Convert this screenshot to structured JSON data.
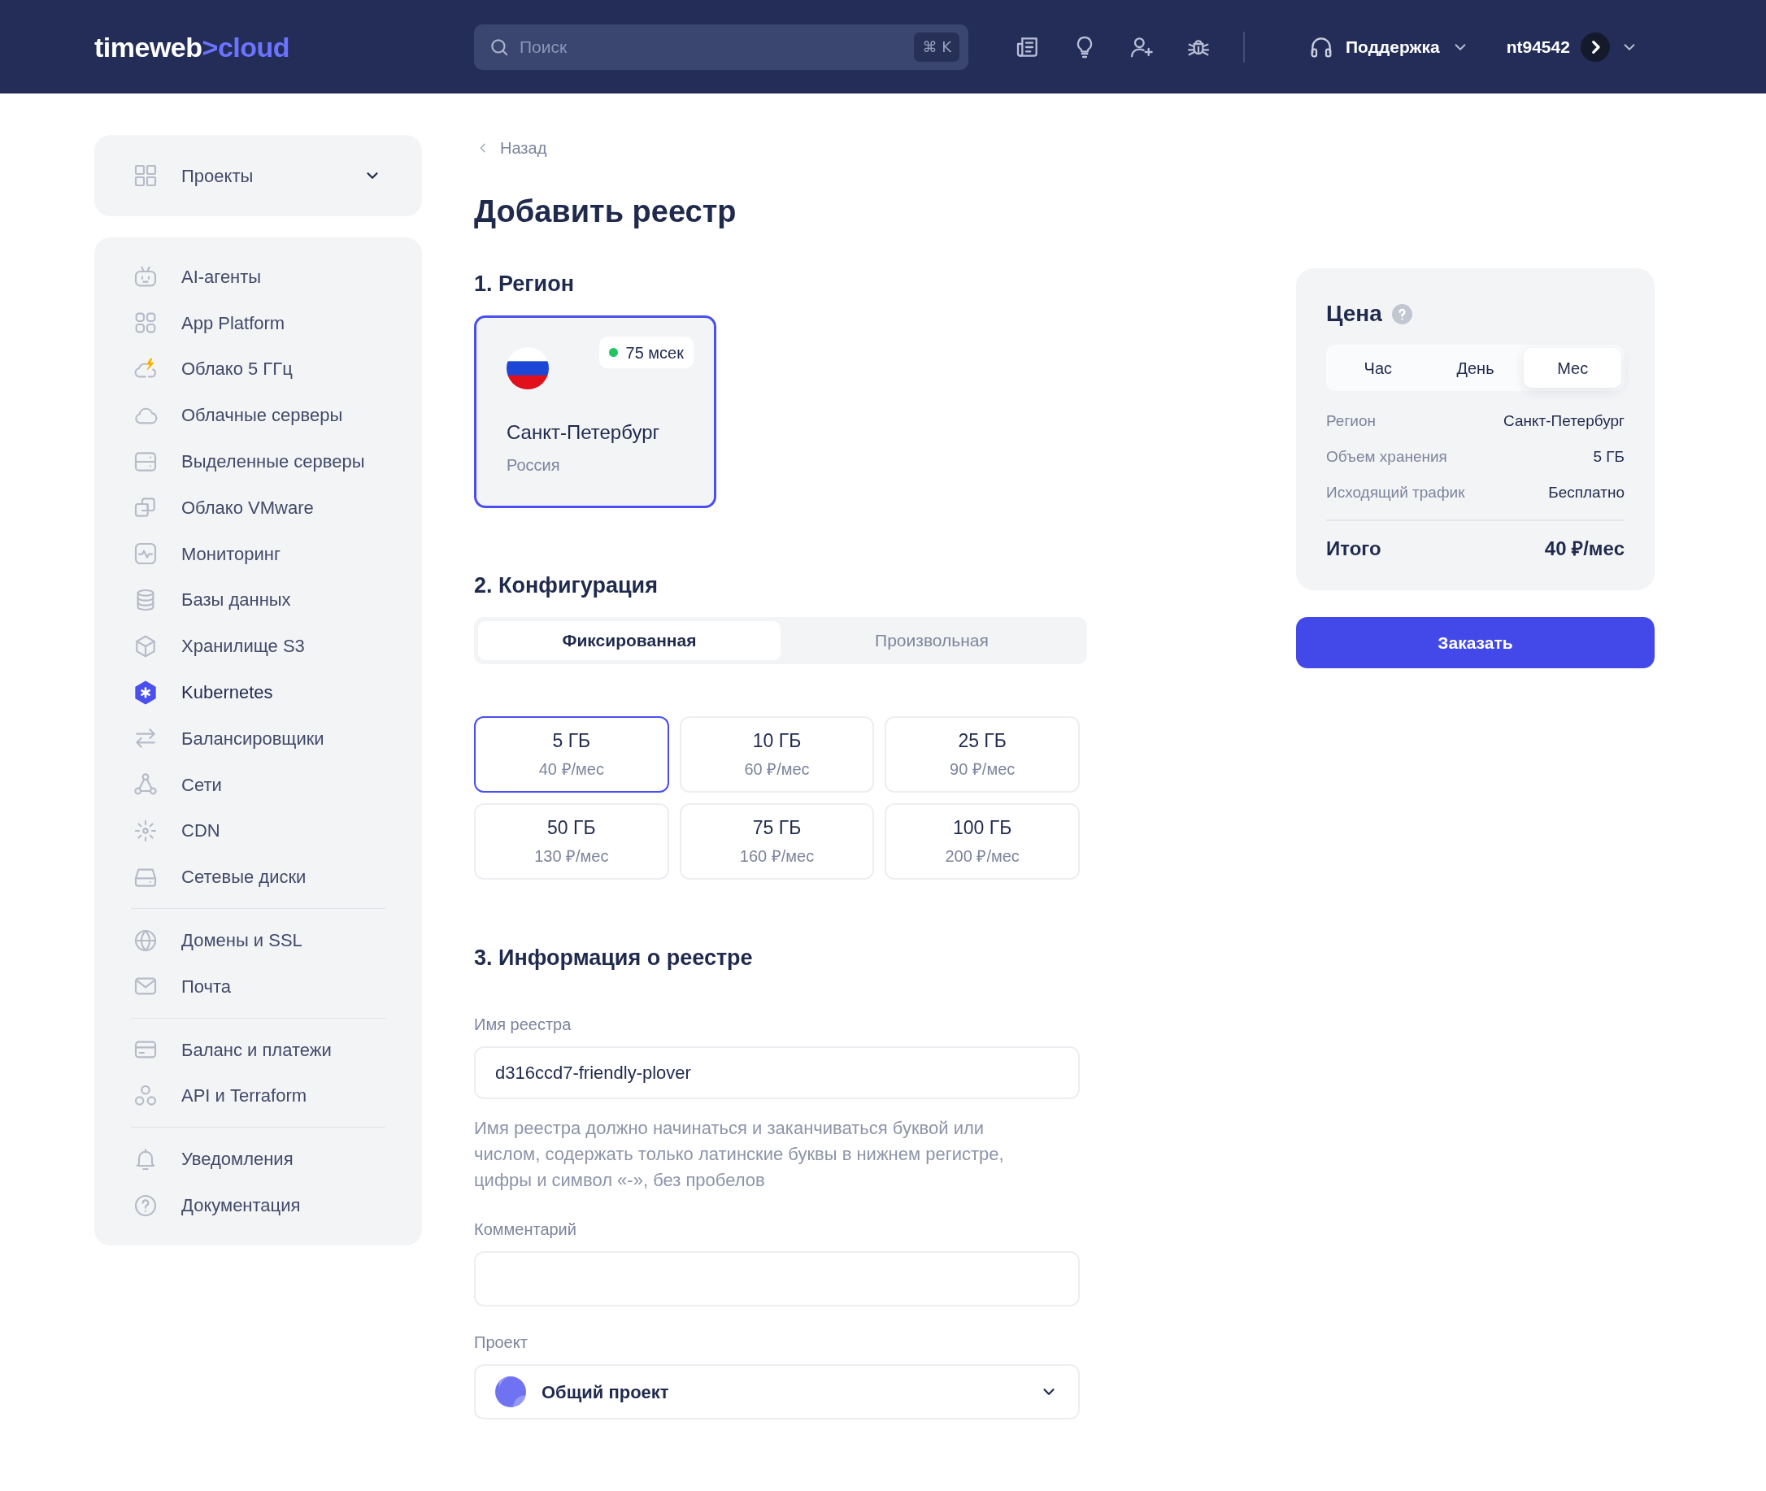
{
  "header": {
    "logo": {
      "wordmark": "timeweb",
      "separator": ">",
      "product": "cloud"
    },
    "search": {
      "placeholder": "Поиск",
      "shortcut": "⌘ K"
    },
    "support": {
      "label": "Поддержка"
    },
    "account": {
      "username": "nt94542"
    }
  },
  "sidebar": {
    "projects": {
      "label": "Проекты"
    },
    "groups": [
      {
        "items": [
          {
            "label": "AI-агенты",
            "selected": false
          },
          {
            "label": "App Platform",
            "selected": false
          },
          {
            "label": "Облако 5 ГГц",
            "selected": false
          },
          {
            "label": "Облачные серверы",
            "selected": false
          },
          {
            "label": "Выделенные серверы",
            "selected": false
          },
          {
            "label": "Облако VMware",
            "selected": false
          },
          {
            "label": "Мониторинг",
            "selected": false
          },
          {
            "label": "Базы данных",
            "selected": false
          },
          {
            "label": "Хранилище S3",
            "selected": false
          },
          {
            "label": "Kubernetes",
            "selected": true
          },
          {
            "label": "Балансировщики",
            "selected": false
          },
          {
            "label": "Сети",
            "selected": false
          },
          {
            "label": "CDN",
            "selected": false
          },
          {
            "label": "Сетевые диски",
            "selected": false
          }
        ]
      },
      {
        "items": [
          {
            "label": "Домены и SSL",
            "selected": false
          },
          {
            "label": "Почта",
            "selected": false
          }
        ]
      },
      {
        "items": [
          {
            "label": "Баланс и платежи",
            "selected": false
          },
          {
            "label": "API и Terraform",
            "selected": false
          }
        ]
      },
      {
        "items": [
          {
            "label": "Уведомления",
            "selected": false
          },
          {
            "label": "Документация",
            "selected": false
          }
        ]
      }
    ]
  },
  "main": {
    "back_link": "Назад",
    "title": "Добавить реестр",
    "region": {
      "heading": "1. Регион",
      "options": [
        {
          "city": "Санкт-Петербург",
          "country": "Россия",
          "ping": "75 мсек",
          "selected": true
        }
      ]
    },
    "configuration": {
      "heading": "2. Конфигурация",
      "modes": [
        {
          "label": "Фиксированная",
          "selected": true
        },
        {
          "label": "Произвольная",
          "selected": false
        }
      ],
      "plans": [
        {
          "size": "5 ГБ",
          "price": "40 ₽/мес",
          "selected": true
        },
        {
          "size": "10 ГБ",
          "price": "60 ₽/мес",
          "selected": false
        },
        {
          "size": "25 ГБ",
          "price": "90 ₽/мес",
          "selected": false
        },
        {
          "size": "50 ГБ",
          "price": "130 ₽/мес",
          "selected": false
        },
        {
          "size": "75 ГБ",
          "price": "160 ₽/мес",
          "selected": false
        },
        {
          "size": "100 ГБ",
          "price": "200 ₽/мес",
          "selected": false
        }
      ]
    },
    "registry_info": {
      "heading": "3. Информация о реестре",
      "name_field": {
        "label": "Имя реестра",
        "value": "d316ccd7-friendly-plover",
        "hint": "Имя реестра должно начинаться и заканчиваться буквой или числом, содержать только латинские буквы в нижнем регистре, цифры и символ «-», без пробелов"
      },
      "comment_field": {
        "label": "Комментарий"
      },
      "project_field": {
        "label": "Проект",
        "value": "Общий проект"
      }
    }
  },
  "price": {
    "title": "Цена",
    "periods": [
      {
        "label": "Час",
        "selected": false
      },
      {
        "label": "День",
        "selected": false
      },
      {
        "label": "Мес",
        "selected": true
      }
    ],
    "rows": [
      {
        "label": "Регион",
        "value": "Санкт-Петербург"
      },
      {
        "label": "Объем хранения",
        "value": "5 ГБ"
      },
      {
        "label": "Исходящий трафик",
        "value": "Бесплатно"
      }
    ],
    "total": {
      "label": "Итого",
      "value": "40 ₽/мес"
    },
    "order_button": "Заказать"
  }
}
